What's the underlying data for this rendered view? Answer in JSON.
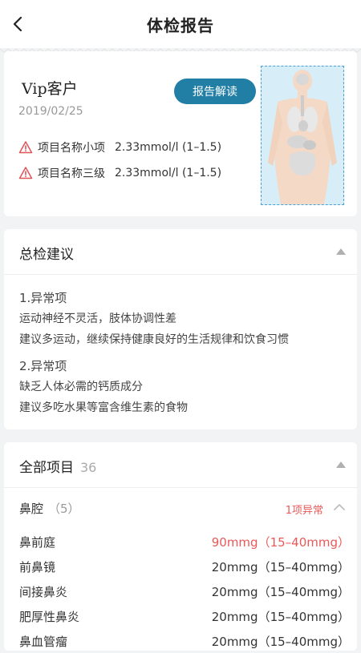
{
  "nav": {
    "title": "体检报告"
  },
  "summary": {
    "customer": "Vip客户",
    "date": "2019/02/25",
    "interpret_label": "报告解读",
    "abnormal_items": [
      {
        "name": "项目名称小项",
        "value": "2.33mmol/l (1–1.5)"
      },
      {
        "name": "项目名称三级",
        "value": "2.33mmol/l (1–1.5)"
      }
    ]
  },
  "advice": {
    "title": "总检建议",
    "blocks": [
      {
        "head": "1.异常项",
        "lines": [
          "运动神经不灵活，肢体协调性差",
          "建议多运动，继续保持健康良好的生活规律和饮食习惯"
        ]
      },
      {
        "head": "2.异常项",
        "lines": [
          "缺乏人体必需的钙质成分",
          "建议多吃水果等富含维生素的食物"
        ]
      }
    ]
  },
  "all_items": {
    "title": "全部项目",
    "count": "36",
    "group": {
      "name": "鼻腔",
      "count": "（5）",
      "abnormal": "1项异常"
    },
    "items": [
      {
        "name": "鼻前庭",
        "value": "90mmg（15–40mmg）",
        "abnormal": true
      },
      {
        "name": "前鼻镜",
        "value": "20mmg（15–40mmg）",
        "abnormal": false
      },
      {
        "name": "间接鼻炎",
        "value": "20mmg（15–40mmg）",
        "abnormal": false
      },
      {
        "name": "肥厚性鼻炎",
        "value": "20mmg（15–40mmg）",
        "abnormal": false
      },
      {
        "name": "鼻血管瘤",
        "value": "20mmg（15–40mmg）",
        "abnormal": false
      }
    ]
  },
  "colors": {
    "accent": "#217ea5",
    "abnormal": "#e85a5a",
    "warning": "#e05555"
  }
}
